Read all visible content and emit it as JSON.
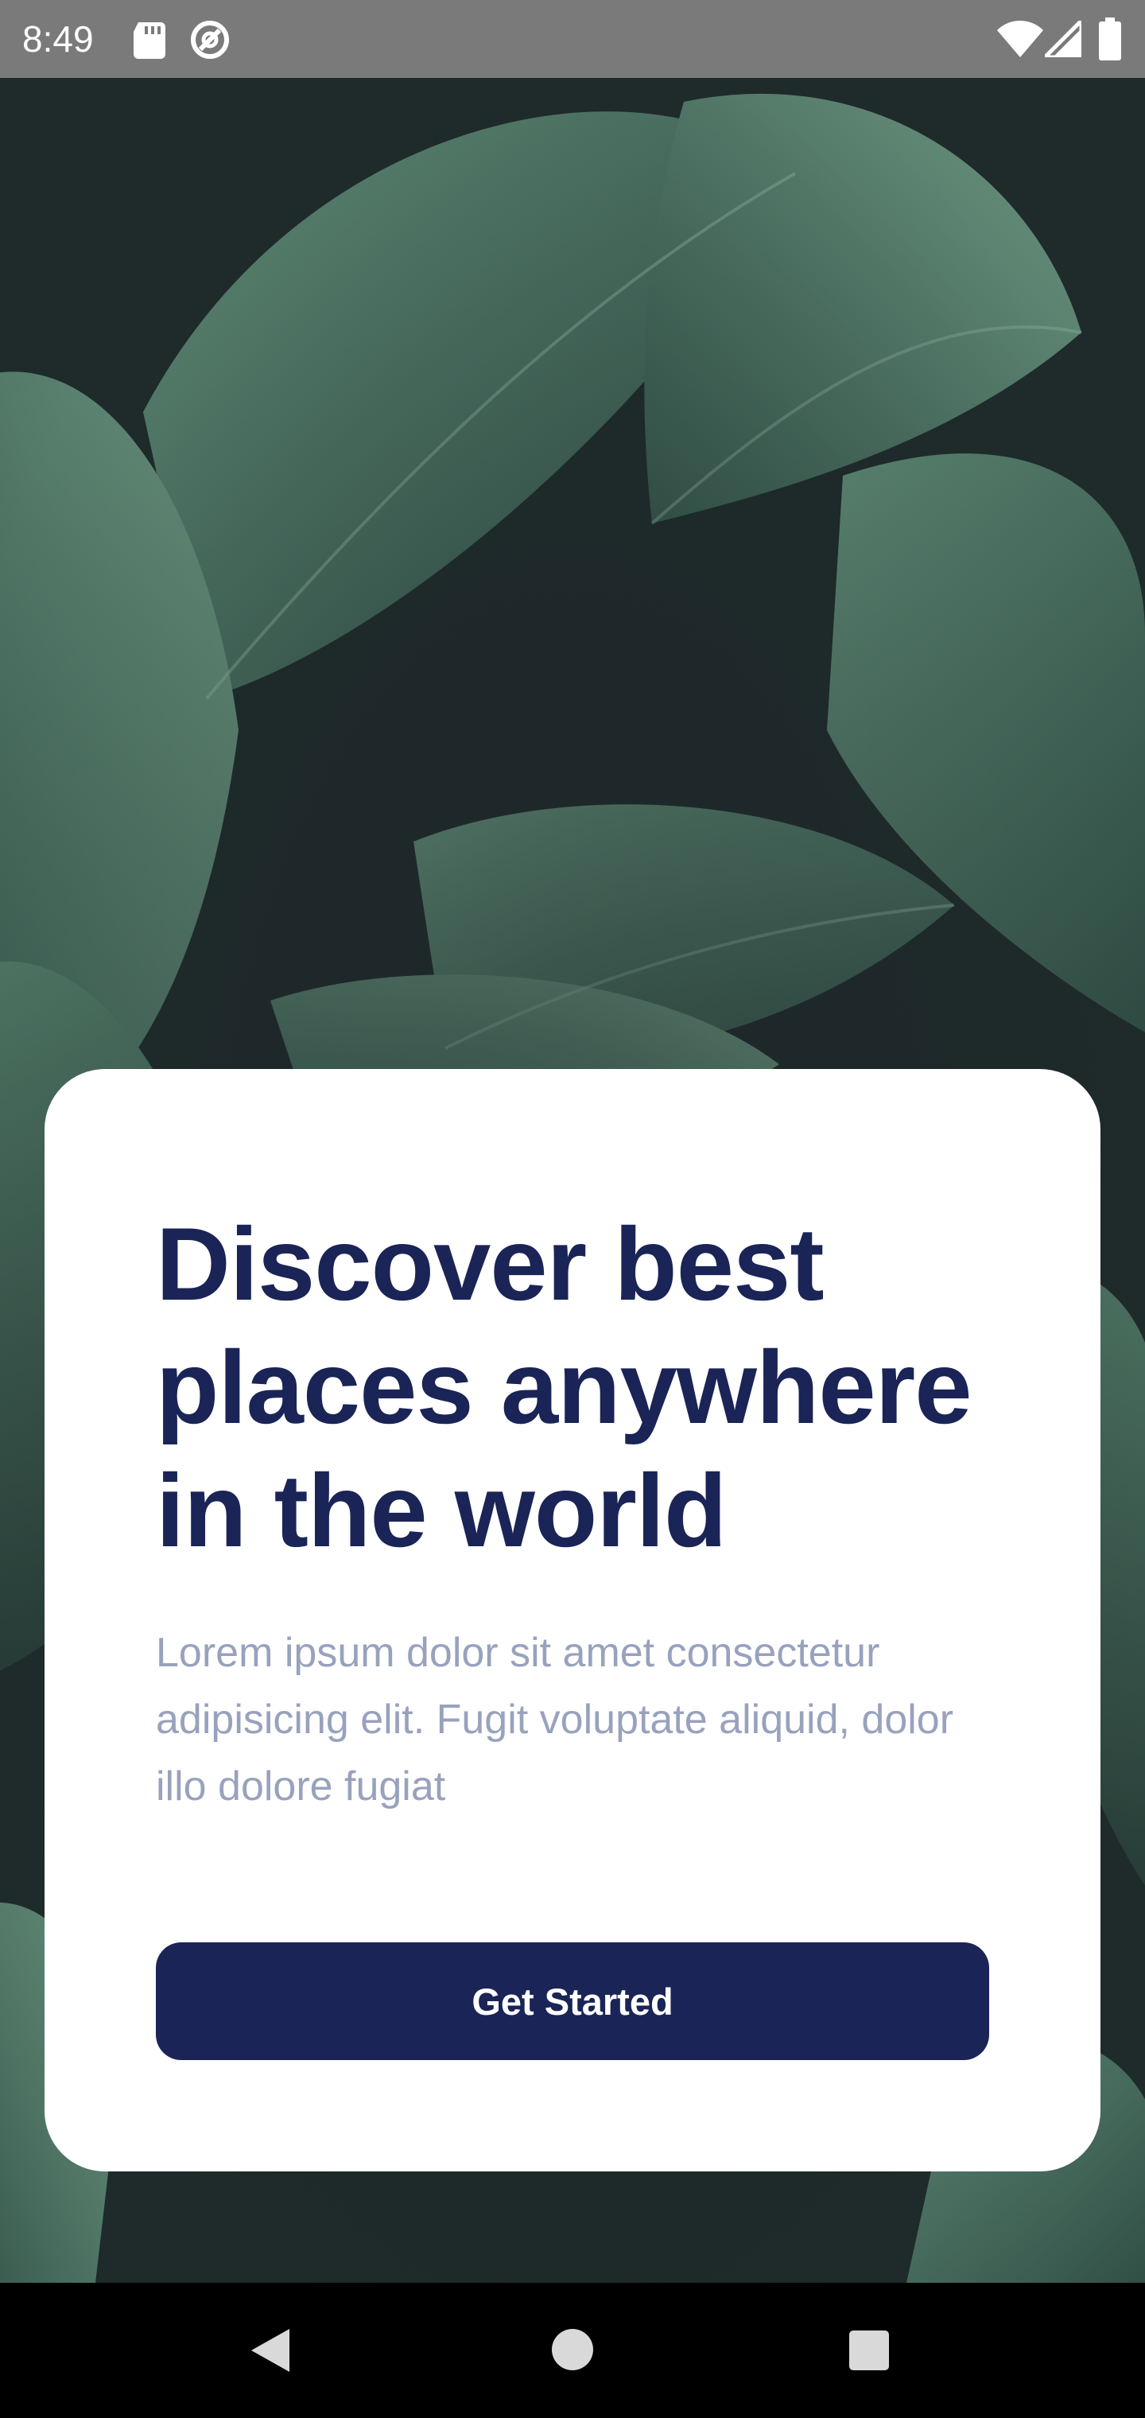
{
  "status_bar": {
    "time": "8:49",
    "icons": [
      "sd-card-icon",
      "sync-icon",
      "wifi-icon",
      "cell-signal-icon",
      "battery-icon"
    ]
  },
  "background": {
    "description_icon": "tropical-leaves-photo",
    "colors": {
      "dark": "#1f2a2b",
      "leaf": "#4e7a66"
    }
  },
  "card": {
    "title": "Discover best places anywhere in the world",
    "body": "Lorem ipsum dolor sit amet consectetur adipisicing elit. Fugit voluptate aliquid, dolor illo dolore fugiat",
    "button_label": "Get Started"
  },
  "nav_bar": {
    "icons": [
      "back-icon",
      "home-icon",
      "recents-icon"
    ]
  },
  "colors": {
    "primary": "#1a2456",
    "body_text": "#98a2bd",
    "card_bg": "#ffffff"
  }
}
